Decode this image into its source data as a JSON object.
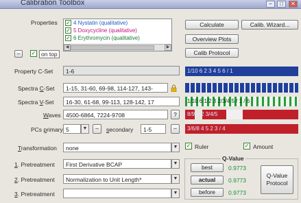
{
  "window": {
    "title": "Calibration Toolbox"
  },
  "properties": {
    "label": "Properties",
    "items": [
      {
        "label": "4 Nystatin (qualitative)",
        "color": "#1c5bc4"
      },
      {
        "label": "5 Doxycycline (qualitative)",
        "color": "#c0147a"
      },
      {
        "label": "6 Erythromycin (qualitative)",
        "color": "#1a7a34"
      }
    ],
    "on_top_label": "on top"
  },
  "buttons": {
    "calculate": "Calculate",
    "calib_wizard": "Calib. Wizard...",
    "overview_plots": "Overview Plots",
    "calib_protocol": "Calib Protocol",
    "best": "best",
    "actual": "actual",
    "before": "before",
    "q_value_protocol": "Q-Value Protocol",
    "waves_help": "?"
  },
  "form": {
    "property_cset_label": "Property C-Set",
    "property_cset_value": "1-6",
    "spectra_cset_label": "Spectra C-Set",
    "spectra_cset_value": "1-15, 31-60, 69-98, 114-127, 143-",
    "spectra_vset_label": "Spectra V-Set",
    "spectra_vset_value": "16-30, 61-68, 99-113, 128-142, 17",
    "waves_label": "Waves",
    "waves_value": "4500-6864, 7224-9708",
    "pcs_primary_label": "PCs primary",
    "pcs_primary_value": "5",
    "secondary_label": "secondary",
    "secondary_value": "1-5",
    "transformation_label": "Transformation",
    "transformation_value": "none",
    "pretreat1_label": "1. Pretreatment",
    "pretreat1_value": "First Derivative BCAP",
    "pretreat2_label": "2. Pretreatment",
    "pretreat2_value": "Normalization to Unit Length*",
    "pretreat3_label": "3. Pretreatment",
    "pretreat3_value": ""
  },
  "bars": {
    "property_bar_text": "1/10 6   2      3      4  5  6 / 1",
    "spectra_v_bar_text": "1/10 6  1/2  3     2/3/4  5 / 1 / 6",
    "waves_bar_text": "8/9  1              2          3/4/5",
    "pcs_bar_text": "3/6/8 4   5                2        3 / 4",
    "colors": {
      "blue": "#1f3f9a",
      "green": "#2a9a3a",
      "red": "#c0202a"
    }
  },
  "options": {
    "ruler_label": "Ruler",
    "amount_label": "Amount"
  },
  "qvalue": {
    "title": "Q-Value",
    "best_value": "0.9773",
    "actual_value": "0.9773",
    "before_value": "0.9773"
  },
  "colors": {
    "qvalue_green": "#1d8f3c",
    "lock_yellow": "#e2b21a"
  }
}
